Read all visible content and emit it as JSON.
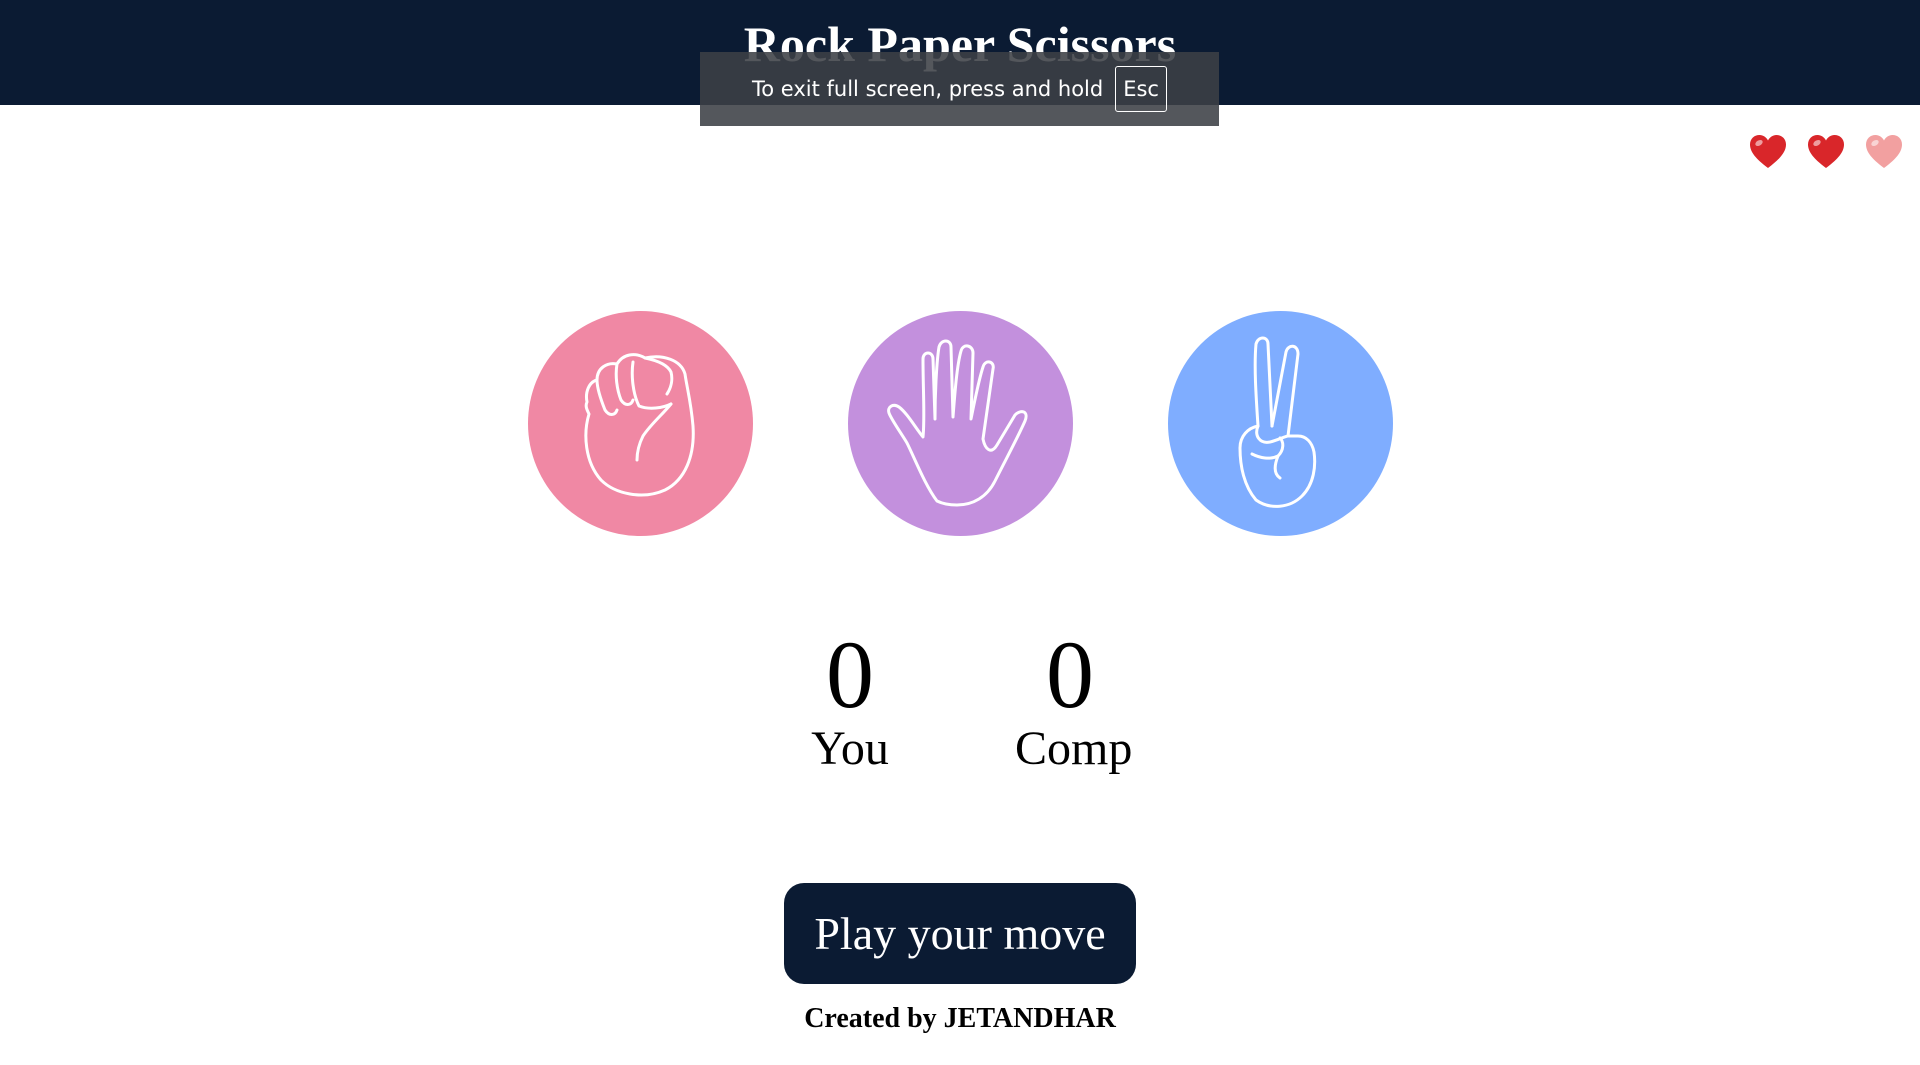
{
  "header": {
    "title": "Rock Paper Scissors"
  },
  "fullscreen_notice": {
    "text": "To exit full screen, press and hold",
    "key": "Esc"
  },
  "lives": {
    "total": 3,
    "remaining": 2,
    "icon": "heart-icon",
    "full_color": "#d9262a",
    "empty_color": "#f2a0a0"
  },
  "choices": [
    {
      "name": "rock",
      "icon": "fist-icon",
      "color": "#f088a4"
    },
    {
      "name": "paper",
      "icon": "open-hand-icon",
      "color": "#c390dd"
    },
    {
      "name": "scissors",
      "icon": "peace-hand-icon",
      "color": "#7fadff"
    }
  ],
  "scores": {
    "you": {
      "value": "0",
      "label": "You"
    },
    "comp": {
      "value": "0",
      "label": "Comp"
    }
  },
  "play_button": {
    "label": "Play your move"
  },
  "footer": {
    "text": "Created by JETANDHAR"
  },
  "colors": {
    "header_bg": "#0b1b33",
    "button_bg": "#0b1b33"
  }
}
